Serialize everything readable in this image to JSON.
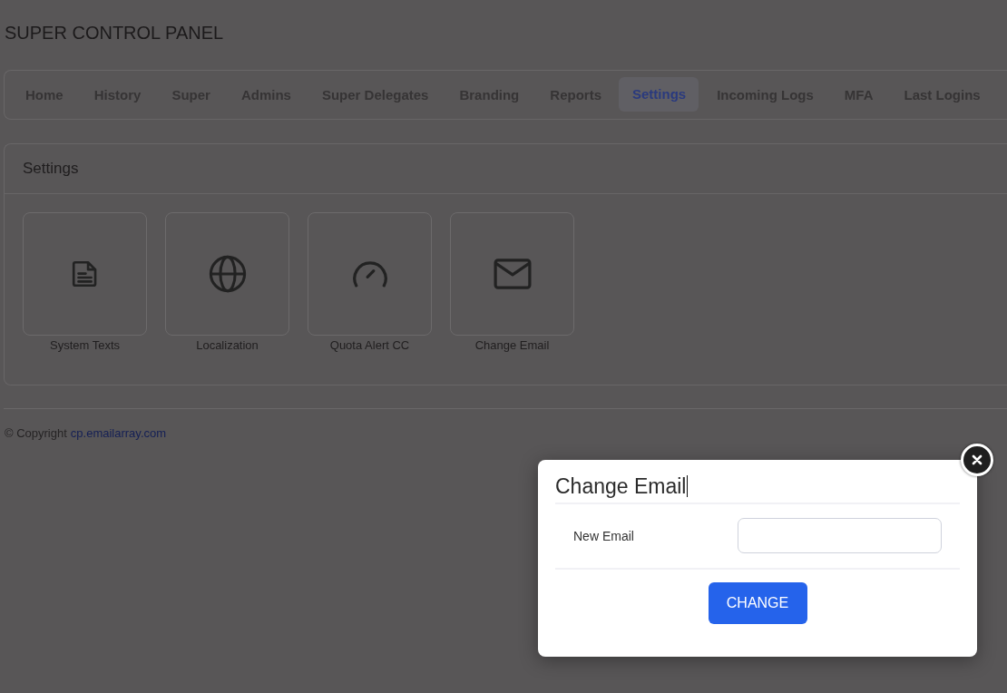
{
  "page_title": "SUPER CONTROL PANEL",
  "tabs": [
    {
      "label": "Home",
      "selected": false
    },
    {
      "label": "History",
      "selected": false
    },
    {
      "label": "Super",
      "selected": false
    },
    {
      "label": "Admins",
      "selected": false
    },
    {
      "label": "Super Delegates",
      "selected": false
    },
    {
      "label": "Branding",
      "selected": false
    },
    {
      "label": "Reports",
      "selected": false
    },
    {
      "label": "Settings",
      "selected": true
    },
    {
      "label": "Incoming Logs",
      "selected": false
    },
    {
      "label": "MFA",
      "selected": false
    },
    {
      "label": "Last Logins",
      "selected": false
    }
  ],
  "settings_card": {
    "title": "Settings",
    "tiles": [
      {
        "label": "System Texts",
        "kind": "document"
      },
      {
        "label": "Localization",
        "kind": "globe"
      },
      {
        "label": "Quota Alert CC",
        "kind": "gauge"
      },
      {
        "label": "Change Email",
        "kind": "envelope"
      }
    ]
  },
  "footer": {
    "prefix": "© Copyright",
    "link": "cp.emailarray.com"
  },
  "modal": {
    "title": "Change Email",
    "fields": [
      {
        "label": "New Email"
      }
    ],
    "button": "CHANGE"
  }
}
